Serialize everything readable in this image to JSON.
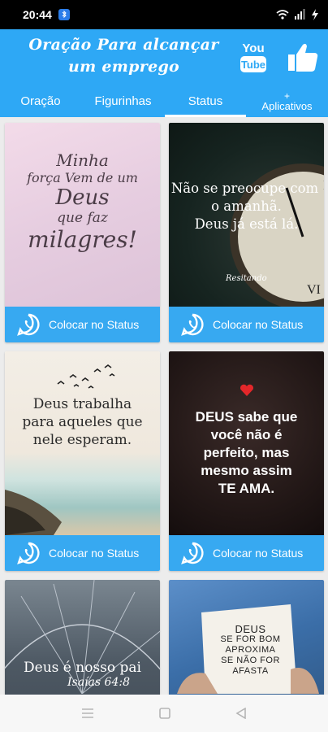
{
  "status_bar": {
    "time": "20:44"
  },
  "header": {
    "title": "Oração Para alcançar um emprego",
    "youtube_icon": "youtube-icon",
    "like_icon": "thumbs-up-icon"
  },
  "tabs": [
    {
      "label": "Oração"
    },
    {
      "label": "Figurinhas"
    },
    {
      "label": "Status",
      "active": true
    },
    {
      "plus": "+",
      "label": "Aplicativos"
    }
  ],
  "cards": [
    {
      "lines": [
        "Minha",
        "força Vem de um",
        "Deus",
        "que faz",
        "milagres!"
      ],
      "button": "Colocar no Status"
    },
    {
      "lines": [
        "Não se preocupe com",
        "o amanhã.",
        "Deus já está lá."
      ],
      "signature": "Resitando",
      "button": "Colocar no Status"
    },
    {
      "lines": [
        "Deus trabalha",
        "para aqueles que",
        "nele esperam."
      ],
      "button": "Colocar no Status"
    },
    {
      "lines": [
        "DEUS sabe que",
        "você não é",
        "perfeito, mas",
        "mesmo assim",
        "TE AMA."
      ],
      "button": "Colocar no Status"
    },
    {
      "lines": [
        "Deus é nosso pai",
        "Isaías 64:8"
      ]
    },
    {
      "lines": [
        "DEUS",
        "SE FOR BOM",
        "APROXIMA",
        "SE NÃO FOR",
        "AFASTA"
      ]
    }
  ],
  "colors": {
    "primary": "#2ea8f5",
    "button": "#37a9f1"
  }
}
